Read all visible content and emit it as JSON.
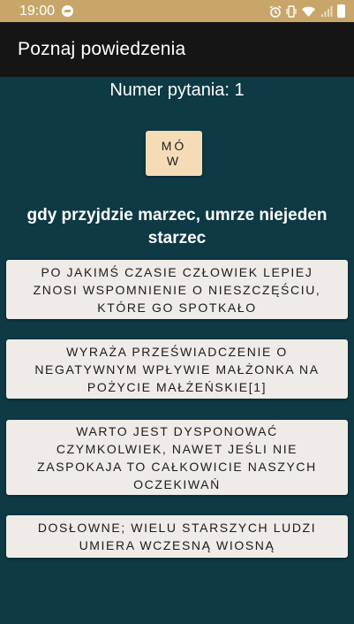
{
  "status_bar": {
    "time": "19:00",
    "notification_icon": "messenger-icon",
    "indicators": [
      "alarm-icon",
      "vibrate-icon",
      "wifi-icon",
      "signal-icon",
      "battery-icon"
    ]
  },
  "app_bar": {
    "title": "Poznaj powiedzenia"
  },
  "question": {
    "number_label": "Numer pytania: 1",
    "speak_button_label": "MÓW",
    "saying": "gdy przyjdzie marzec, umrze niejeden starzec"
  },
  "answers": [
    "PO JAKIMŚ CZASIE CZŁOWIEK LEPIEJ ZNOSI WSPOMNIENIE O NIESZCZĘŚCIU, KTÓRE GO SPOTKAŁO",
    "WYRAŻA PRZEŚWIADCZENIE O NEGATYWNYM WPŁYWIE MAŁŻONKA NA POŻYCIE MAŁŻEŃSKIE[1]",
    "WARTO JEST DYSPONOWAĆ CZYMKOLWIEK, NAWET JEŚLI NIE ZASPOKAJA TO CAŁKOWICIE NASZYCH OCZEKIWAŃ",
    "DOSŁOWNE; WIELU STARSZYCH LUDZI UMIERA WCZESNĄ WIOSNĄ"
  ],
  "colors": {
    "status_bar": "#c8a66a",
    "app_bar": "#151515",
    "background": "#0d3a45",
    "speak_button": "#f5dcb6",
    "answer_button": "#efebe6"
  }
}
